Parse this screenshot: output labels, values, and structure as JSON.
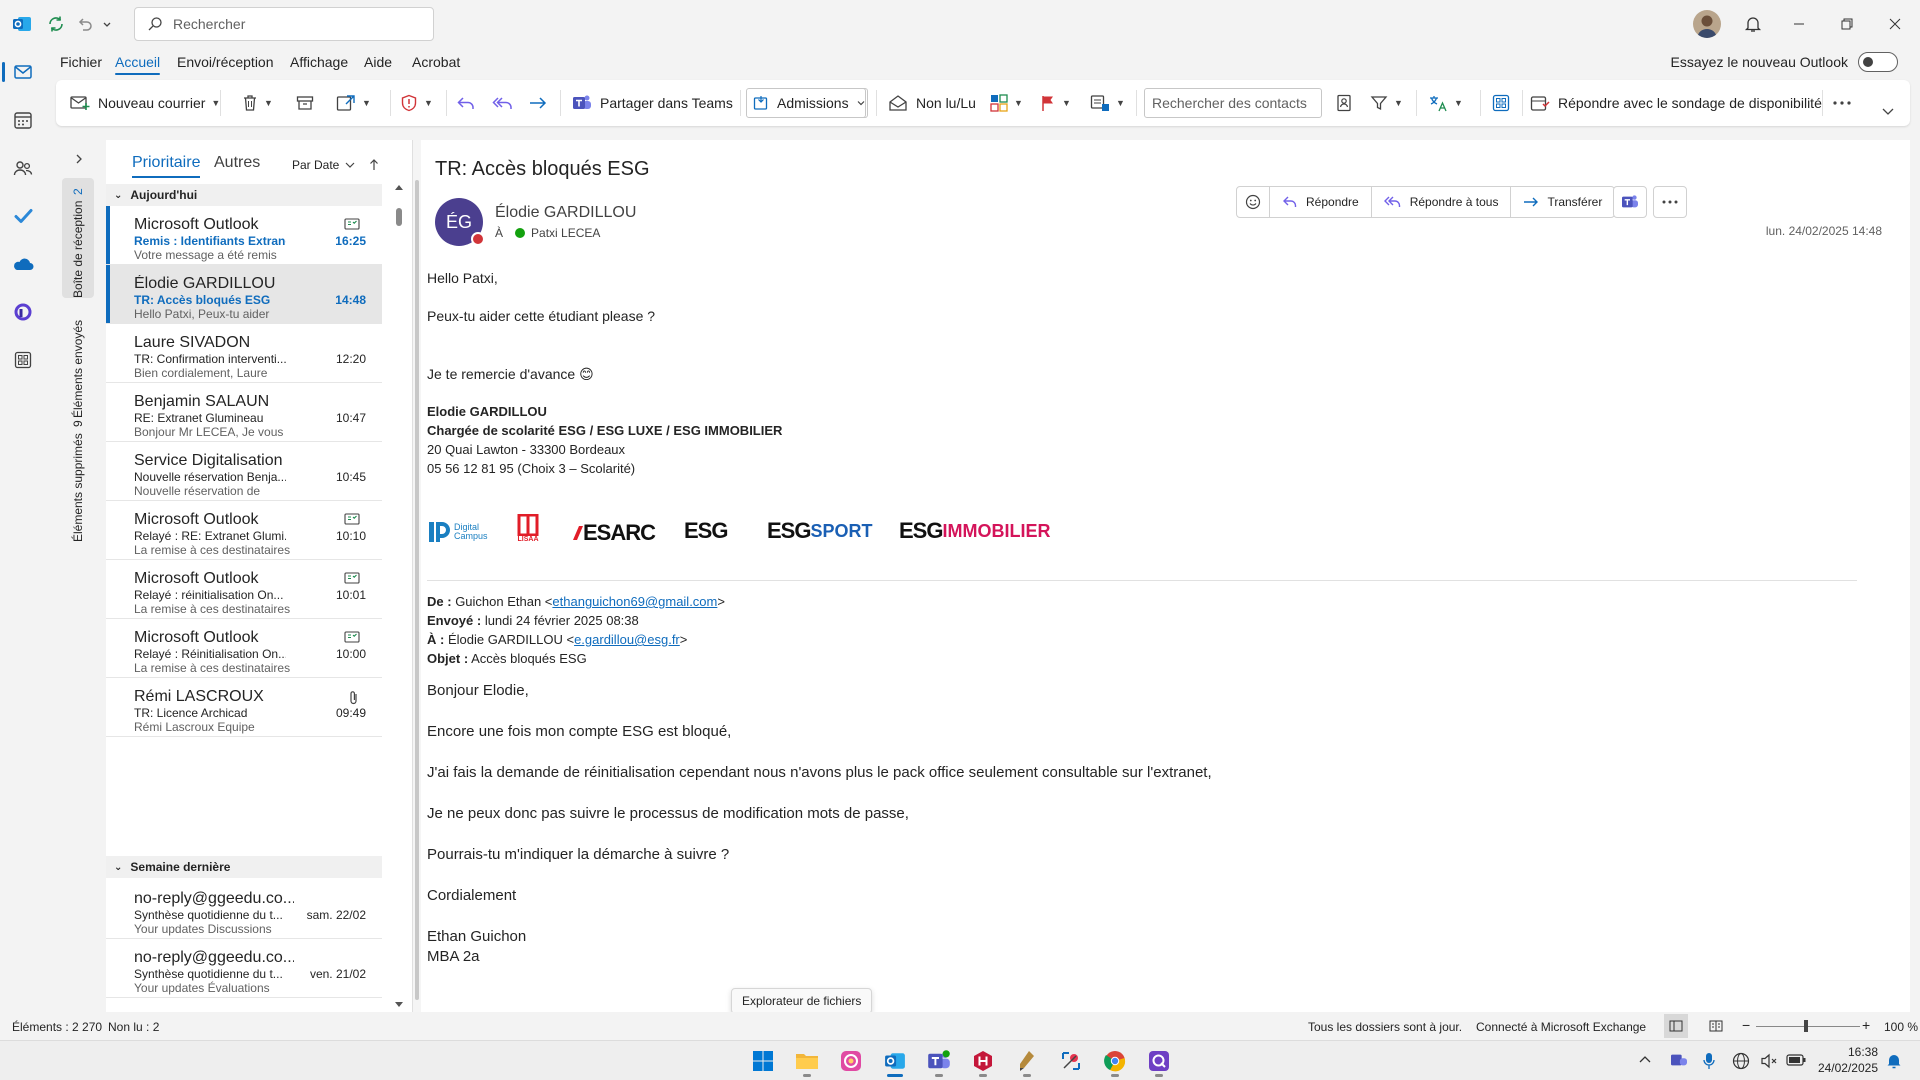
{
  "titlebar": {
    "search_placeholder": "Rechercher"
  },
  "menu": {
    "tabs": [
      "Fichier",
      "Accueil",
      "Envoi/réception",
      "Affichage",
      "Aide",
      "Acrobat"
    ],
    "try_new_label": "Essayez le nouveau Outlook"
  },
  "ribbon": {
    "new_mail": "Nouveau courrier",
    "share_teams": "Partager dans Teams",
    "quick_step": "Admissions",
    "read_unread": "Non lu/Lu",
    "contact_search_placeholder": "Rechercher des contacts",
    "availability_poll": "Répondre avec le sondage de disponibilité"
  },
  "folders": {
    "inbox": {
      "label": "Boîte de réception",
      "count": "2"
    },
    "sent": {
      "label": "Éléments envoyés"
    },
    "deleted": {
      "label": "Éléments supprimés",
      "count": "9"
    }
  },
  "list": {
    "tab_focused": "Prioritaire",
    "tab_other": "Autres",
    "sort_label": "Par Date",
    "group_today": "Aujourd'hui",
    "group_last_week": "Semaine dernière",
    "items": [
      {
        "sender": "Microsoft Outlook",
        "subject": "Remis : Identifiants Extranet",
        "preview": "Votre message a été remis",
        "time": "16:25",
        "unread": true,
        "icon": "receipt-icon"
      },
      {
        "sender": "Élodie GARDILLOU",
        "subject": "TR: Accès bloqués ESG",
        "preview": "Hello Patxi,  Peux-tu aider",
        "time": "14:48",
        "unread": true,
        "selected": true
      },
      {
        "sender": "Laure SIVADON",
        "subject": "TR: Confirmation interventi...",
        "preview": "Bien cordialement,  Laure",
        "time": "12:20"
      },
      {
        "sender": "Benjamin SALAUN",
        "subject": "RE: Extranet Glumineau",
        "preview": "Bonjour Mr LECEA,  Je vous",
        "time": "10:47"
      },
      {
        "sender": "Service Digitalisation",
        "subject": "Nouvelle réservation Benja...",
        "preview": "Nouvelle réservation de",
        "time": "10:45"
      },
      {
        "sender": "Microsoft Outlook",
        "subject": "Relayé : RE: Extranet Glumi...",
        "preview": "La remise à ces destinataires",
        "time": "10:10",
        "icon": "receipt-icon"
      },
      {
        "sender": "Microsoft Outlook",
        "subject": "Relayé : réinitialisation On...",
        "preview": "La remise à ces destinataires",
        "time": "10:01",
        "icon": "receipt-icon"
      },
      {
        "sender": "Microsoft Outlook",
        "subject": "Relayé : Réinitialisation On...",
        "preview": "La remise à ces destinataires",
        "time": "10:00",
        "icon": "receipt-icon"
      },
      {
        "sender": "Rémi LASCROUX",
        "subject": "TR: Licence Archicad",
        "preview": "Rémi Lascroux  Equipe",
        "time": "09:49",
        "icon": "paperclip-icon"
      }
    ],
    "last_week_items": [
      {
        "sender": "no-reply@ggeedu.co...",
        "subject": "Synthèse quotidienne du t...",
        "preview": "Your updates  Discussions",
        "time": "sam. 22/02"
      },
      {
        "sender": "no-reply@ggeedu.co...",
        "subject": "Synthèse quotidienne du t...",
        "preview": "Your updates  Évaluations",
        "time": "ven. 21/02"
      }
    ]
  },
  "reading": {
    "subject": "TR: Accès bloqués ESG",
    "avatar_initials": "ÉG",
    "from": "Élodie GARDILLOU",
    "to_prefix": "À",
    "to": "Patxi LECEA",
    "date": "lun. 24/02/2025 14:48",
    "actions": {
      "reply": "Répondre",
      "reply_all": "Répondre à tous",
      "forward": "Transférer"
    },
    "body": {
      "greeting": "Hello Patxi,",
      "line1": "Peux-tu aider cette étudiant please ?",
      "thanks": "Je te remercie d'avance 😊",
      "sig_name": "Elodie GARDILLOU",
      "sig_title": "Chargée de scolarité ESG / ESG LUXE / ESG IMMOBILIER",
      "sig_address": "20 Quai Lawton - 33300 Bordeaux",
      "sig_phone": "05 56 12 81 95 (Choix 3 – Scolarité)",
      "logos": {
        "digital_campus": "Digital Campus",
        "lisaa": "LISAA",
        "esarc": "ESARC",
        "esg": "ESG",
        "esg_sport_a": "ESG",
        "esg_sport_b": "SPORT",
        "esg_immo_a": "ESG",
        "esg_immo_b": "IMMOBILIER"
      },
      "fwd_from_label": "De :",
      "fwd_from_name": "Guichon Ethan <",
      "fwd_from_email": "ethanguichon69@gmail.com",
      "fwd_close": ">",
      "fwd_sent_label": "Envoyé :",
      "fwd_sent": "lundi 24 février 2025 08:38",
      "fwd_to_label": "À :",
      "fwd_to_name": "Élodie GARDILLOU <",
      "fwd_to_email": "e.gardillou@esg.fr",
      "fwd_subject_label": "Objet :",
      "fwd_subject": "Accès bloqués ESG",
      "p1": "Bonjour Elodie,",
      "p2": "Encore une fois mon compte ESG est bloqué,",
      "p3": "J'ai fais la demande de réinitialisation cependant nous n'avons plus le pack office seulement consultable sur l'extranet,",
      "p4": "Je ne peux donc pas suivre le processus de modification mots de passe,",
      "p5": "Pourrais-tu m'indiquer la démarche à suivre ?",
      "p6": "Cordialement",
      "p7": "Ethan Guichon",
      "p8": "MBA 2a"
    }
  },
  "tooltip": "Explorateur de fichiers",
  "status": {
    "items": "Éléments : 2 270",
    "unread": "Non lu : 2",
    "sync": "Tous les dossiers sont à jour.",
    "connection": "Connecté à Microsoft Exchange",
    "zoom": "100 %"
  },
  "clock": {
    "time": "16:38",
    "date": "24/02/2025"
  },
  "colors": {
    "accent": "#0f6cbd",
    "avatar": "#4b3f8f",
    "presence_busy": "#d13438",
    "presence_ok": "#13a10e"
  }
}
